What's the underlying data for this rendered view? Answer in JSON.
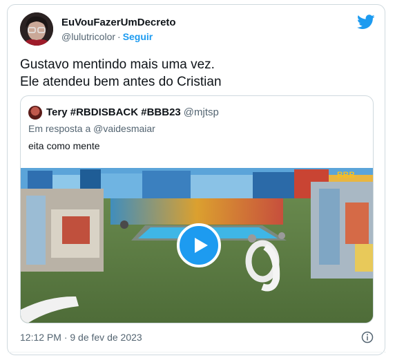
{
  "tweet": {
    "author_name": "EuVouFazerUmDecreto",
    "author_handle": "@lulutricolor",
    "separator": "·",
    "follow_label": "Seguir",
    "text_line1": "Gustavo mentindo mais uma vez.",
    "text_line2": "Ele atendeu bem antes do Cristian",
    "timestamp": "12:12 PM · 9 de fev de 2023",
    "brand_icon": "twitter-bird-icon",
    "brand_color": "#1d9bf0"
  },
  "quoted_tweet": {
    "author_name": "Tery #RBDISBACK #BBB23",
    "author_handle": "@mjtsp",
    "reply_prefix": "Em resposta a",
    "reply_to": "@vaidesmaiar",
    "text": "eita como mente",
    "media": {
      "type": "video",
      "overlay_icon": "play-icon",
      "watermark": "BBB"
    }
  },
  "colors": {
    "text_primary": "#0f1419",
    "text_secondary": "#536471",
    "border": "#cfd9de",
    "accent": "#1d9bf0"
  }
}
